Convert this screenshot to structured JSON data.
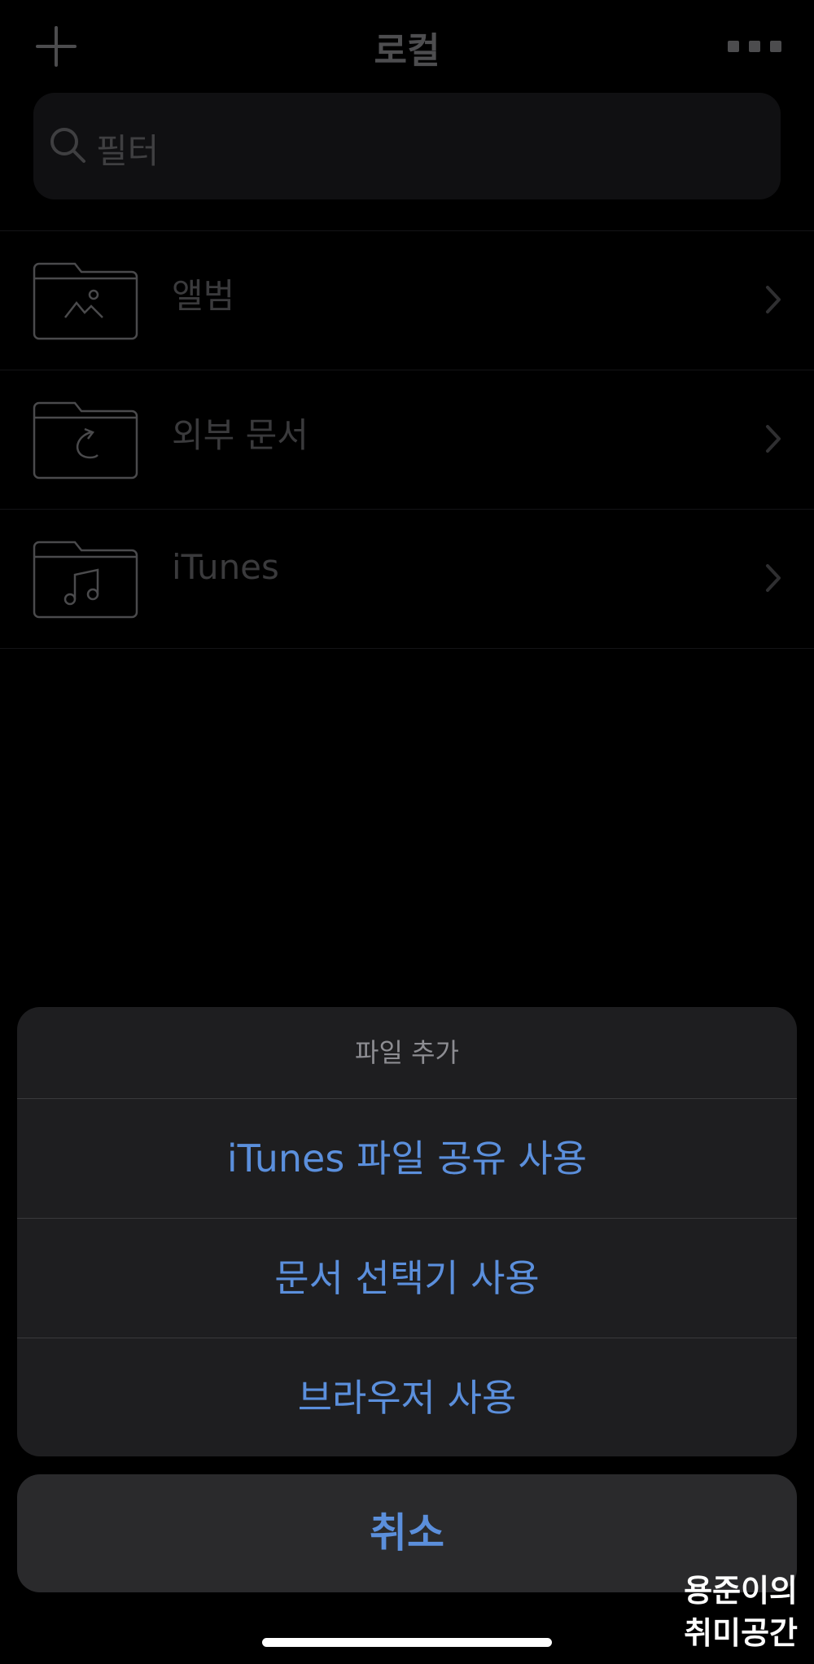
{
  "header": {
    "title": "로컬",
    "add_icon": "plus-icon",
    "more_icon": "ellipsis-icon"
  },
  "search": {
    "placeholder": "필터",
    "icon": "magnifier-icon"
  },
  "folders": [
    {
      "label": "앨범",
      "icon": "folder-photo-icon"
    },
    {
      "label": "외부 문서",
      "icon": "folder-import-icon"
    },
    {
      "label": "iTunes",
      "icon": "folder-music-icon"
    }
  ],
  "action_sheet": {
    "title": "파일 추가",
    "actions": [
      {
        "label": "iTunes 파일 공유 사용"
      },
      {
        "label": "문서 선택기 사용"
      },
      {
        "label": "브라우저 사용"
      }
    ],
    "cancel": "취소"
  },
  "watermark": {
    "line1": "용준이의",
    "line2": "취미공간"
  },
  "colors": {
    "accent": "#5b8fdc",
    "sheet_bg": "#1e1e20",
    "background": "#000000"
  }
}
